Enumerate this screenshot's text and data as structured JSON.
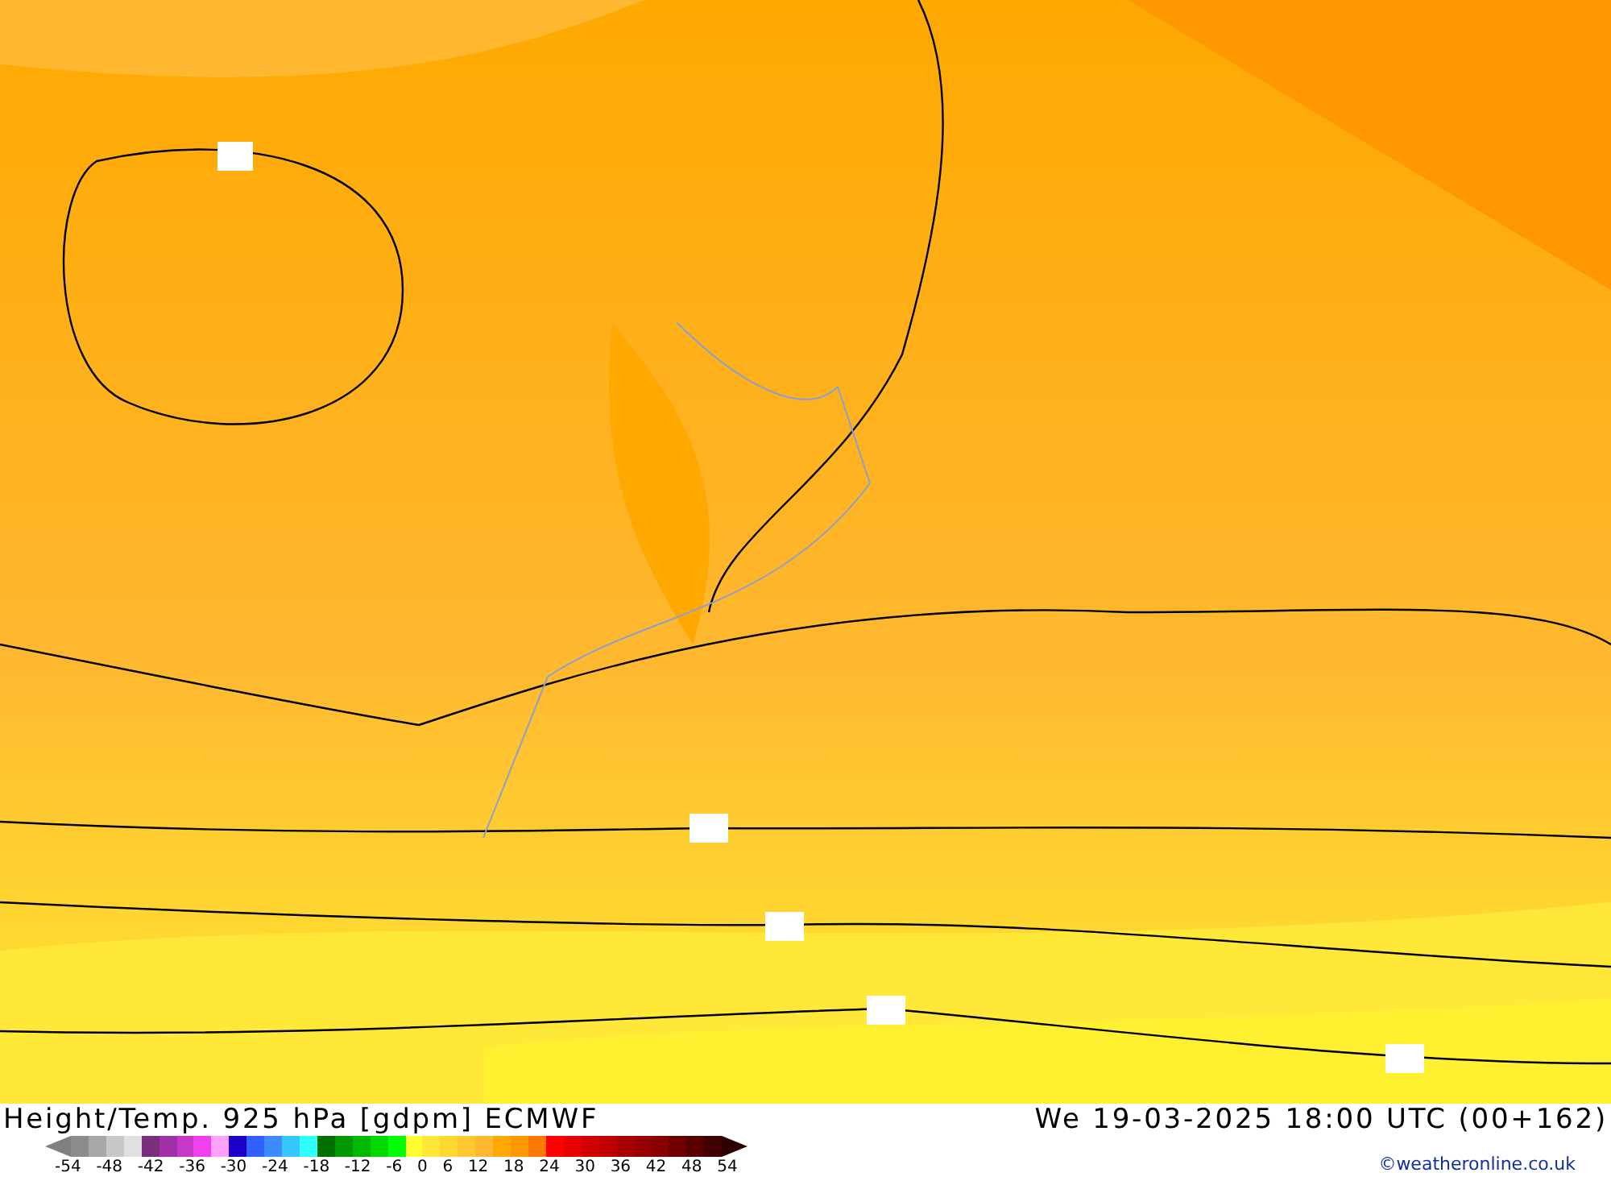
{
  "footer": {
    "title": "Height/Temp. 925 hPa [gdpm] ECMWF",
    "valid_time": "We 19-03-2025 18:00 UTC (00+162)",
    "copyright": "©weatheronline.co.uk"
  },
  "legend": {
    "swatches": [
      {
        "kind": "arrow-left",
        "color": "#808080"
      },
      {
        "color": "#8c8c8c"
      },
      {
        "color": "#a8a8a8"
      },
      {
        "color": "#c8c8c8"
      },
      {
        "color": "#e0e0e0"
      },
      {
        "color": "#78307c"
      },
      {
        "color": "#a030a8"
      },
      {
        "color": "#c838c8"
      },
      {
        "color": "#f040f0"
      },
      {
        "color": "#ffa0ff"
      },
      {
        "color": "#1c00c8"
      },
      {
        "color": "#3060ff"
      },
      {
        "color": "#3c8cff"
      },
      {
        "color": "#34c8ff"
      },
      {
        "color": "#30ffff"
      },
      {
        "color": "#007000"
      },
      {
        "color": "#009800"
      },
      {
        "color": "#00b800"
      },
      {
        "color": "#00d800"
      },
      {
        "color": "#00ff00"
      },
      {
        "color": "#ffff30"
      },
      {
        "color": "#ffe838"
      },
      {
        "color": "#ffd830"
      },
      {
        "color": "#ffc830"
      },
      {
        "color": "#ffb830"
      },
      {
        "color": "#ffa800"
      },
      {
        "color": "#ff9800"
      },
      {
        "color": "#ff7800"
      },
      {
        "color": "#ff0000"
      },
      {
        "color": "#e80000"
      },
      {
        "color": "#d00000"
      },
      {
        "color": "#c00000"
      },
      {
        "color": "#a80000"
      },
      {
        "color": "#980000"
      },
      {
        "color": "#880000"
      },
      {
        "color": "#700000"
      },
      {
        "color": "#580000"
      },
      {
        "color": "#400000"
      },
      {
        "kind": "arrow-right",
        "color": "#300000"
      }
    ],
    "labels": [
      "-54",
      "-48",
      "-42",
      "-36",
      "-30",
      "-24",
      "-18",
      "-12",
      "-6",
      "0",
      "6",
      "12",
      "18",
      "24",
      "30",
      "36",
      "42",
      "48",
      "54"
    ]
  }
}
